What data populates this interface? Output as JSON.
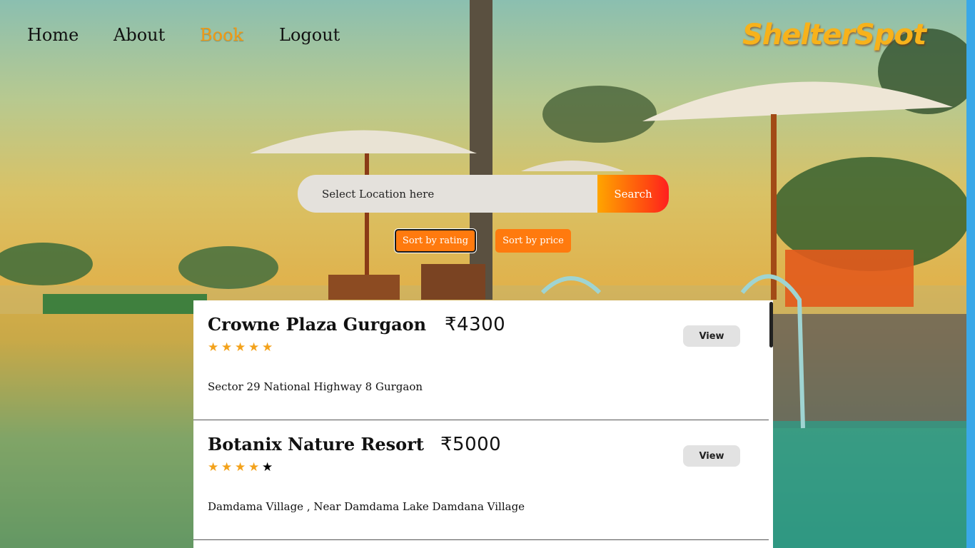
{
  "nav": {
    "home": "Home",
    "about": "About",
    "book": "Book",
    "logout": "Logout"
  },
  "brand": "ShelterSpot",
  "search": {
    "placeholder": "Select Location here",
    "button": "Search"
  },
  "sort": {
    "rating": "Sort by rating",
    "price": "Sort by price"
  },
  "colors": {
    "accent": "#ff7a0e",
    "active_nav": "#f39a12",
    "star": "#f3a21b"
  },
  "hotels": [
    {
      "name": "Crowne Plaza Gurgaon",
      "price": "₹4300",
      "rating": 5,
      "address": "Sector 29 National Highway 8 Gurgaon",
      "view": "View"
    },
    {
      "name": "Botanix Nature Resort",
      "price": "₹5000",
      "rating": 4,
      "address": "Damdama Village , Near Damdama Lake Damdana Village",
      "view": "View"
    }
  ]
}
